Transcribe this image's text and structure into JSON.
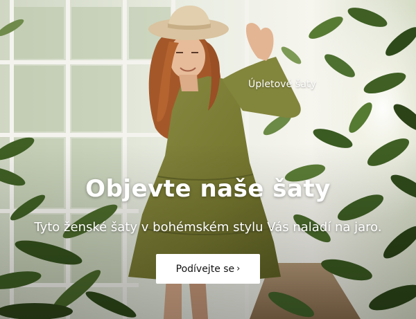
{
  "banner": {
    "product_tag": "Úpletové šaty",
    "headline": "Objevte naše šaty",
    "subline": "Tyto ženské šaty v bohémském stylu Vás naladí na jaro.",
    "cta_label": "Podívejte se",
    "cta_chevron": "›"
  },
  "colors": {
    "dress": "#7a7c38",
    "hair": "#a4582a",
    "hat": "#d9c3a0",
    "foliage": "#3f5f24",
    "cta_background": "#ffffff",
    "text": "#ffffff"
  },
  "icons": {
    "cta_chevron": "chevron-right-icon"
  }
}
